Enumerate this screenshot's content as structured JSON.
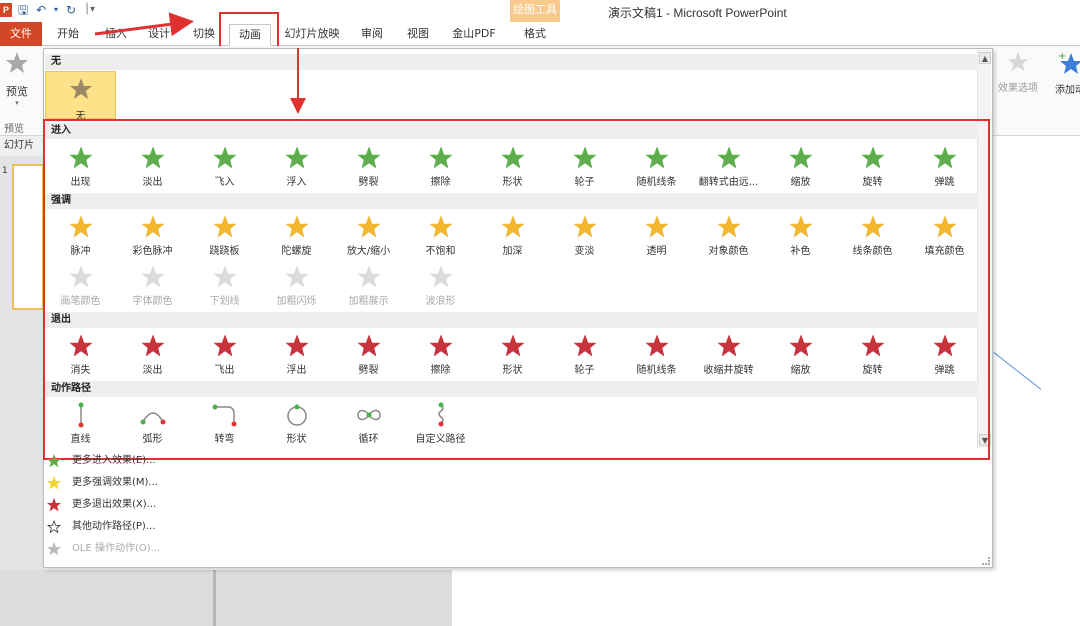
{
  "window": {
    "title": "演示文稿1 - Microsoft PowerPoint",
    "context_tools": "绘图工具"
  },
  "quick_access": {
    "app_icon": "P",
    "save_icon": "save-icon",
    "undo_icon": "undo-icon",
    "redo_icon": "redo-icon",
    "customize_icon": "customize-qa-icon"
  },
  "tabs": [
    {
      "label": "文件"
    },
    {
      "label": "开始"
    },
    {
      "label": "插入"
    },
    {
      "label": "设计"
    },
    {
      "label": "切换"
    },
    {
      "label": "动画"
    },
    {
      "label": "幻灯片放映"
    },
    {
      "label": "审阅"
    },
    {
      "label": "视图"
    },
    {
      "label": "金山PDF"
    },
    {
      "label": "格式"
    }
  ],
  "ribbon": {
    "preview_label": "预览",
    "preview_group": "预览",
    "effect_options": "效果选项",
    "add_animation": "添加动"
  },
  "slides_pane": {
    "header": "幻灯片",
    "slide_number": "1"
  },
  "gallery": {
    "none_section": "无",
    "none_item": "无",
    "sections": {
      "entrance": {
        "title": "进入",
        "items": [
          "出现",
          "淡出",
          "飞入",
          "浮入",
          "劈裂",
          "擦除",
          "形状",
          "轮子",
          "随机线条",
          "翻转式由远...",
          "缩放",
          "旋转",
          "弹跳"
        ]
      },
      "emphasis": {
        "title": "强调",
        "items": [
          "脉冲",
          "彩色脉冲",
          "跷跷板",
          "陀螺旋",
          "放大/缩小",
          "不饱和",
          "加深",
          "变淡",
          "透明",
          "对象颜色",
          "补色",
          "线条颜色",
          "填充颜色"
        ],
        "disabled_items": [
          "画笔颜色",
          "字体颜色",
          "下划线",
          "加粗闪烁",
          "加粗展示",
          "波浪形"
        ]
      },
      "exit": {
        "title": "退出",
        "items": [
          "消失",
          "淡出",
          "飞出",
          "浮出",
          "劈裂",
          "擦除",
          "形状",
          "轮子",
          "随机线条",
          "收缩并旋转",
          "缩放",
          "旋转",
          "弹跳"
        ]
      },
      "motion": {
        "title": "动作路径",
        "items": [
          "直线",
          "弧形",
          "转弯",
          "形状",
          "循环",
          "自定义路径"
        ]
      }
    },
    "menu": [
      {
        "label": "更多进入效果(E)...",
        "icon": "green-star-icon",
        "disabled": false
      },
      {
        "label": "更多强调效果(M)...",
        "icon": "yellow-star-icon",
        "disabled": false
      },
      {
        "label": "更多退出效果(X)...",
        "icon": "red-star-icon",
        "disabled": false
      },
      {
        "label": "其他动作路径(P)...",
        "icon": "outline-star-icon",
        "disabled": false
      },
      {
        "label": "OLE 操作动作(O)...",
        "icon": "ole-icon",
        "disabled": true
      }
    ]
  },
  "colors": {
    "file_tab": "#d24726",
    "annotation_red": "#e03131",
    "entrance_green": "#5fae4e",
    "emphasis_gold": "#f2b632",
    "exit_red": "#c8323c",
    "path_green": "#4caf50"
  }
}
